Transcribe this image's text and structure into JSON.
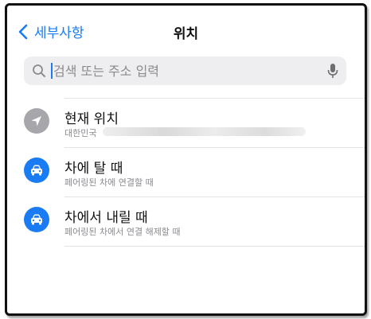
{
  "nav": {
    "back_label": "세부사항",
    "title": "위치"
  },
  "search": {
    "placeholder": "검색 또는 주소 입력",
    "value": ""
  },
  "items": [
    {
      "title": "현재 위치",
      "subtitle": "대한민국",
      "icon": "location-arrow-icon",
      "icon_bg": "#a6a6ab"
    },
    {
      "title": "차에 탈 때",
      "subtitle": "페어링된 차에 연결할 때",
      "icon": "car-icon",
      "icon_bg": "#1a7cf5"
    },
    {
      "title": "차에서 내릴 때",
      "subtitle": "페어링된 차에서 연결 해제할 때",
      "icon": "car-icon",
      "icon_bg": "#1a7cf5"
    }
  ],
  "colors": {
    "accent": "#1a7cf5",
    "secondary_text": "#8a8a8f"
  }
}
